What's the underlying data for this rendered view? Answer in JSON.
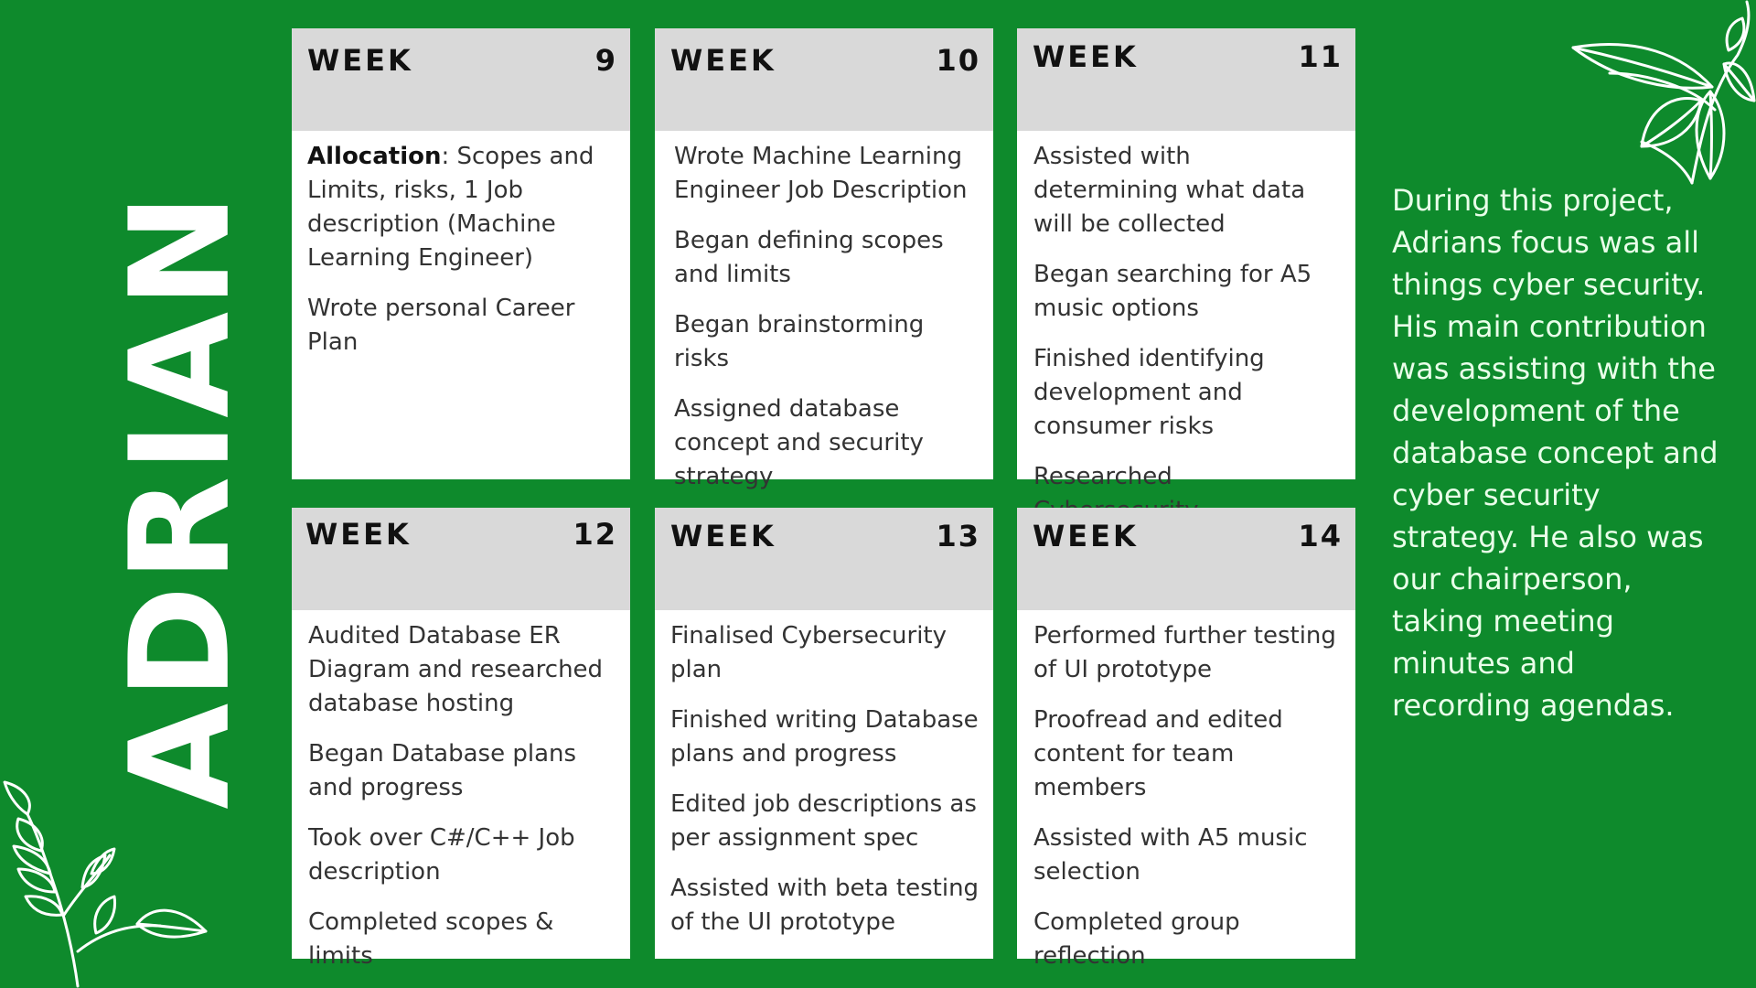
{
  "name": "ADRIAN",
  "week_label": "WEEK",
  "weeks": [
    {
      "number": "9",
      "items": [
        {
          "bold": "Allocation",
          "text": ": Scopes and Limits, risks, 1 Job description (Machine Learning Engineer)"
        },
        {
          "text": "Wrote personal Career Plan"
        }
      ]
    },
    {
      "number": "10",
      "items": [
        {
          "text": "Wrote Machine Learning Engineer Job Description"
        },
        {
          "text": "Began defining scopes and limits"
        },
        {
          "text": "Began brainstorming risks"
        },
        {
          "text": "Assigned database concept and security strategy"
        }
      ]
    },
    {
      "number": "11",
      "items": [
        {
          "text": "Assisted with determining what data will be collected"
        },
        {
          "text": "Began searching for A5 music options"
        },
        {
          "text": "Finished identifying development and consumer risks"
        },
        {
          "text": "Researched Cybersecurity"
        }
      ]
    },
    {
      "number": "12",
      "items": [
        {
          "text": "Audited Database ER Diagram and researched database hosting"
        },
        {
          "text": "Began Database plans and progress"
        },
        {
          "text": "Took over C#/C++ Job description"
        },
        {
          "text": "Completed scopes & limits"
        }
      ]
    },
    {
      "number": "13",
      "items": [
        {
          "text": "Finalised Cybersecurity plan"
        },
        {
          "text": "Finished writing Database plans and progress"
        },
        {
          "text": "Edited job descriptions as per assignment spec"
        },
        {
          "text": "Assisted with beta testing of the UI prototype"
        }
      ]
    },
    {
      "number": "14",
      "items": [
        {
          "text": "Performed further testing of UI prototype"
        },
        {
          "text": "Proofread and edited content for team members"
        },
        {
          "text": "Assisted with A5 music selection"
        },
        {
          "text": "Completed group reflection"
        }
      ]
    }
  ],
  "summary": "During this project, Adrians focus was all things cyber security. His main contribution was assisting with the development of the database concept and cyber security strategy. He also was our chairperson, taking meeting minutes and recording agendas.",
  "colors": {
    "background": "#0e8a2c",
    "card_header": "#d9d9d9",
    "card_body": "#ffffff",
    "text_dark": "#111111",
    "text_light": "#ffffff"
  },
  "decorations": [
    "leaf-branch-top-right-icon",
    "leaf-branch-bottom-left-icon"
  ]
}
